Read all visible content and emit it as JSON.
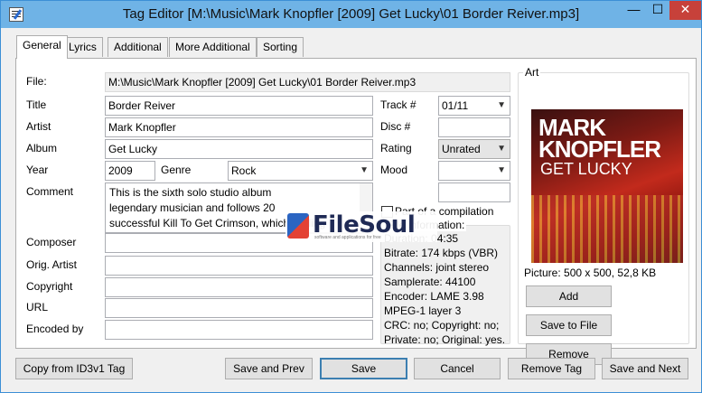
{
  "window": {
    "title": "Tag Editor [M:\\Music\\Mark Knopfler [2009] Get Lucky\\01 Border Reiver.mp3]",
    "minimize": "—",
    "maximize": "☐",
    "close": "✕"
  },
  "tabs": [
    "General",
    "Lyrics",
    "Additional",
    "More Additional",
    "Sorting"
  ],
  "active_tab": "General",
  "labels": {
    "file": "File:",
    "title": "Title",
    "artist": "Artist",
    "album": "Album",
    "year": "Year",
    "genre": "Genre",
    "comment": "Comment",
    "composer": "Composer",
    "orig_artist": "Orig. Artist",
    "copyright": "Copyright",
    "url": "URL",
    "encoded_by": "Encoded by",
    "track": "Track #",
    "disc": "Disc #",
    "rating": "Rating",
    "mood": "Mood",
    "compilation": "Part of a compilation",
    "art": "Art",
    "file_info": "File information:"
  },
  "fields": {
    "file": "M:\\Music\\Mark Knopfler [2009] Get Lucky\\01 Border Reiver.mp3",
    "title": "Border Reiver",
    "artist": "Mark Knopfler",
    "album": "Get Lucky",
    "year": "2009",
    "genre": "Rock",
    "comment": "This is the sixth solo studio album legendary musician and follows 20 successful Kill To Get Crimson, which Rolling",
    "composer": "",
    "orig_artist": "",
    "copyright": "",
    "url": "",
    "encoded_by": "",
    "track": "01/11",
    "disc": "",
    "rating": "Unrated",
    "mood": "",
    "compilation_checked": false
  },
  "comment_lines": [
    "This is the sixth solo studio album",
    "legendary musician and follows 20",
    "successful Kill To Get Crimson, which Rolling"
  ],
  "file_info": [
    "Duration: 04:35",
    "Bitrate: 174 kbps (VBR)",
    "Channels: joint stereo",
    "Samplerate: 44100",
    "Encoder: LAME 3.98",
    "MPEG-1 layer 3",
    "CRC: no; Copyright: no;",
    "Private: no; Original: yes."
  ],
  "art": {
    "cover_artist": "MARK KNOPFLER",
    "cover_album": "GET LUCKY",
    "picture_info": "Picture: 500 x 500, 52,8 KB",
    "add": "Add",
    "save_to_file": "Save to File",
    "remove": "Remove"
  },
  "watermark": {
    "text": "FileSoul",
    "sub": "software and applications for free"
  },
  "buttons": {
    "copy_from_id3v1": "Copy from ID3v1 Tag",
    "save_and_prev": "Save and Prev",
    "save": "Save",
    "cancel": "Cancel",
    "remove_tag": "Remove Tag",
    "save_and_next": "Save and Next"
  },
  "colors": {
    "titlebar": "#6fb3e6",
    "close_button": "#c7413a",
    "default_button_border": "#3c7fb1"
  }
}
